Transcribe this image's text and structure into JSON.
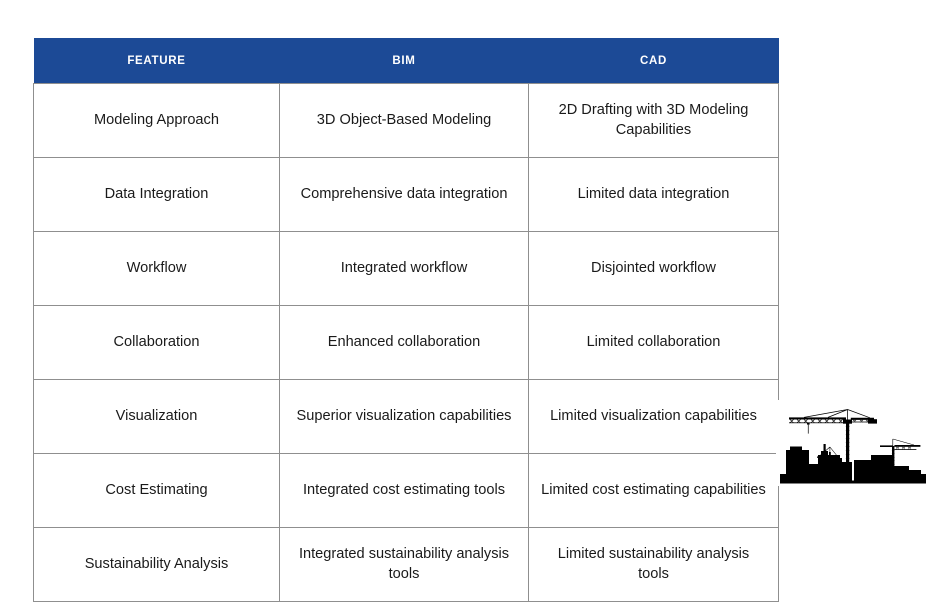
{
  "table": {
    "headers": [
      "FEATURE",
      "BIM",
      "CAD"
    ],
    "rows": [
      {
        "feature": "Modeling Approach",
        "bim": "3D Object-Based Modeling",
        "cad": "2D Drafting with 3D Modeling Capabilities"
      },
      {
        "feature": "Data Integration",
        "bim": "Comprehensive data integration",
        "cad": "Limited data integration"
      },
      {
        "feature": "Workflow",
        "bim": "Integrated workflow",
        "cad": "Disjointed workflow"
      },
      {
        "feature": "Collaboration",
        "bim": "Enhanced collaboration",
        "cad": "Limited collaboration"
      },
      {
        "feature": "Visualization",
        "bim": "Superior visualization capabilities",
        "cad": "Limited visualization capabilities"
      },
      {
        "feature": "Cost Estimating",
        "bim": "Integrated cost estimating tools",
        "cad": "Limited cost estimating capabilities"
      },
      {
        "feature": "Sustainability Analysis",
        "bim": "Integrated sustainability analysis tools",
        "cad": "Limited sustainability analysis tools"
      }
    ]
  },
  "artwork": {
    "name": "construction-site-silhouette",
    "description": "Black silhouette of a construction site with tower cranes and buildings"
  },
  "colors": {
    "header_background": "#1c4a96",
    "header_text": "#ffffff",
    "cell_text": "#1a1a1a",
    "border": "#8f8f8f",
    "page_background": "#ffffff",
    "silhouette": "#000000"
  }
}
